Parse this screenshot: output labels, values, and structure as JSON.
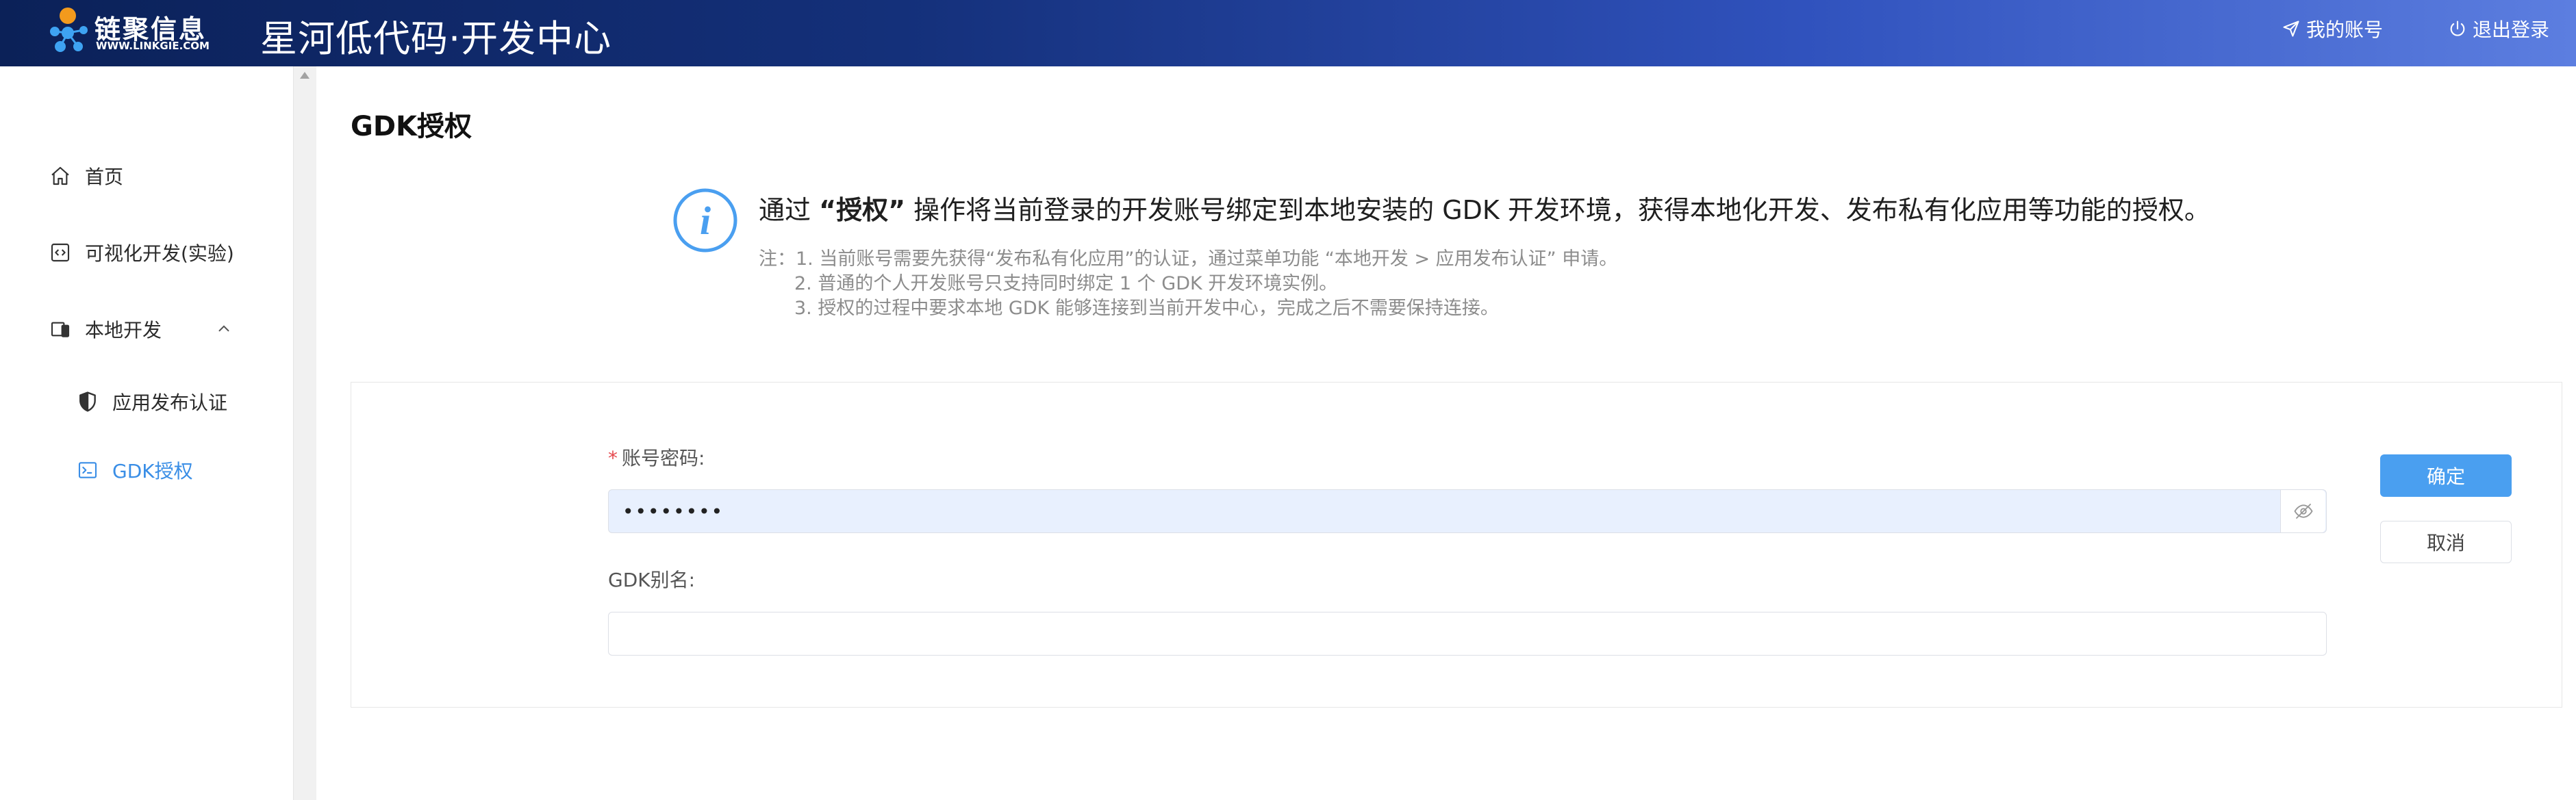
{
  "header": {
    "logo_cn": "链聚信息",
    "logo_en": "WWW.LINKGIE.COM",
    "app_title": "星河低代码·开发中心",
    "account_label": "我的账号",
    "logout_label": "退出登录",
    "gradient_start": "#0b2158",
    "gradient_end": "#5c7ee0"
  },
  "sidebar": {
    "items": [
      {
        "label": "首页",
        "icon": "home-icon"
      },
      {
        "label": "可视化开发(实验)",
        "icon": "code-icon"
      },
      {
        "label": "本地开发",
        "icon": "devices-icon",
        "expanded": true
      },
      {
        "label": "应用发布认证",
        "icon": "shield-icon"
      },
      {
        "label": "GDK授权",
        "icon": "terminal-icon",
        "active": true
      }
    ]
  },
  "main": {
    "title": "GDK授权",
    "info_prefix": "通过 ",
    "info_bold": "“授权”",
    "info_suffix": " 操作将当前登录的开发账号绑定到本地安装的 GDK 开发环境，获得本地化开发、发布私有化应用等功能的授权。",
    "notes": [
      "注：1. 当前账号需要先获得“发布私有化应用”的认证，通过菜单功能 “本地开发 > 应用发布认证” 申请。",
      "2. 普通的个人开发账号只支持同时绑定 1 个 GDK 开发环境实例。",
      "3. 授权的过程中要求本地 GDK 能够连接到当前开发中心，完成之后不需要保持连接。"
    ],
    "form": {
      "password_label": "账号密码:",
      "password_value": "••••••••",
      "alias_label": "GDK别名:",
      "alias_value": "",
      "confirm_label": "确定",
      "cancel_label": "取消"
    }
  },
  "colors": {
    "accent": "#3a8ee6",
    "primary_button": "#4a9ff0",
    "required": "#e5484d"
  }
}
